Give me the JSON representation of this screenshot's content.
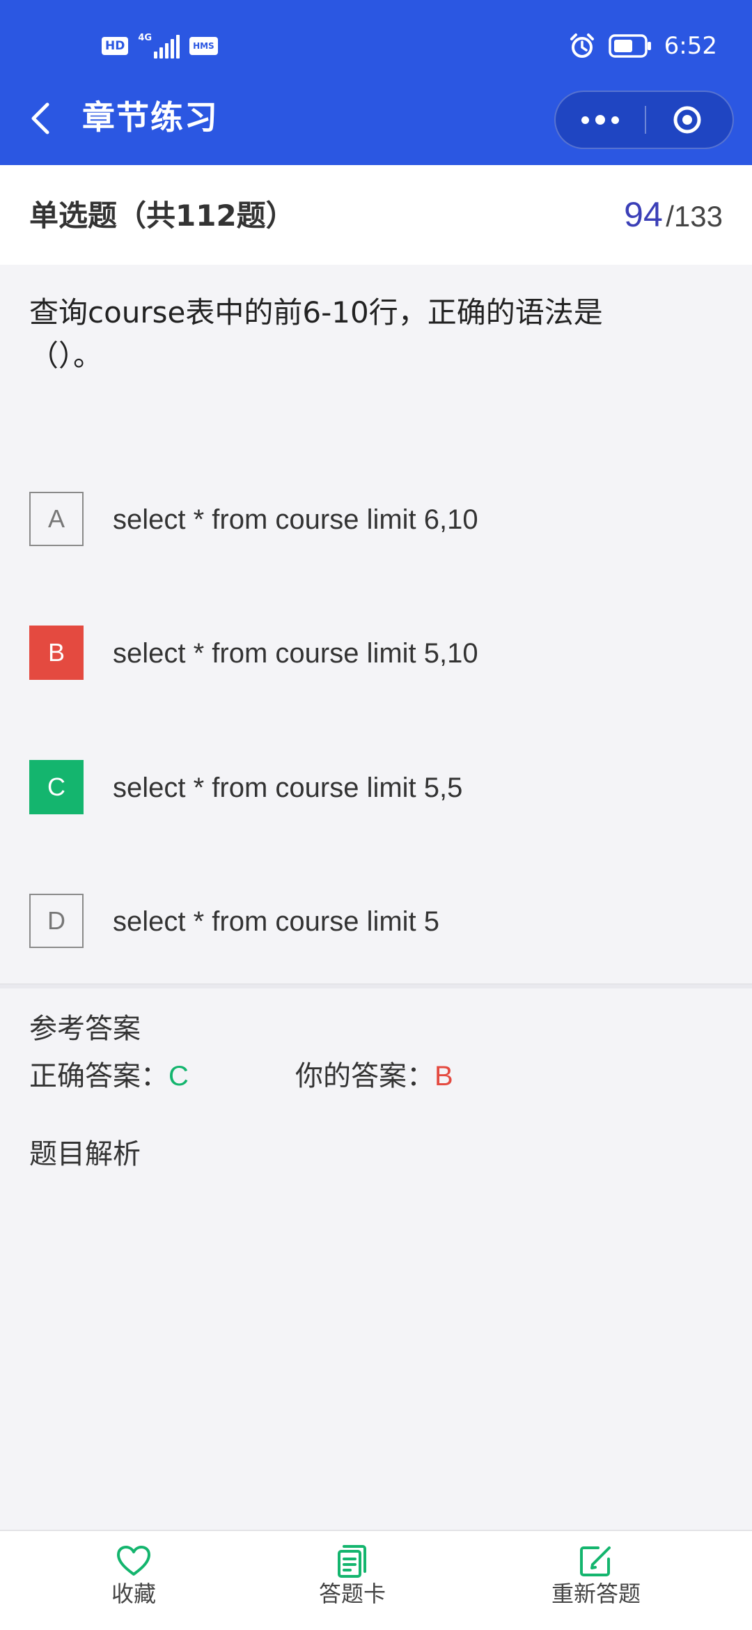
{
  "status_bar": {
    "left_badges": [
      "HD",
      "HMS"
    ],
    "network": "4G",
    "time": "6:52"
  },
  "nav": {
    "title": "章节练习"
  },
  "question_header": {
    "type_label": "单选题（共112题）",
    "current": "94",
    "total": "/133"
  },
  "question": {
    "text": "查询course表中的前6-10行，正确的语法是（）。"
  },
  "options": [
    {
      "letter": "A",
      "text": "select * from course limit 6,10",
      "state": "normal"
    },
    {
      "letter": "B",
      "text": "select * from course limit 5,10",
      "state": "wrong"
    },
    {
      "letter": "C",
      "text": "select * from course limit 5,5",
      "state": "correct"
    },
    {
      "letter": "D",
      "text": "select * from course limit 5",
      "state": "normal"
    }
  ],
  "reference": {
    "title": "参考答案",
    "correct_label": "正确答案：",
    "correct_value": "C",
    "yours_label": "你的答案：",
    "yours_value": "B",
    "analysis_title": "题目解析"
  },
  "bottom_bar": {
    "favorite": "收藏",
    "answer_card": "答题卡",
    "redo": "重新答题"
  },
  "colors": {
    "brand_blue": "#2b57e2",
    "wrong_red": "#e44a40",
    "correct_green": "#14b56e",
    "progress_purple": "#3b3fb7"
  },
  "icons": {
    "back": "chevron-left-icon",
    "more": "more-dots-icon",
    "close": "target-circle-icon",
    "favorite": "heart-icon",
    "answer_card": "answer-card-icon",
    "redo": "edit-icon",
    "alarm": "alarm-icon",
    "battery": "battery-icon"
  }
}
